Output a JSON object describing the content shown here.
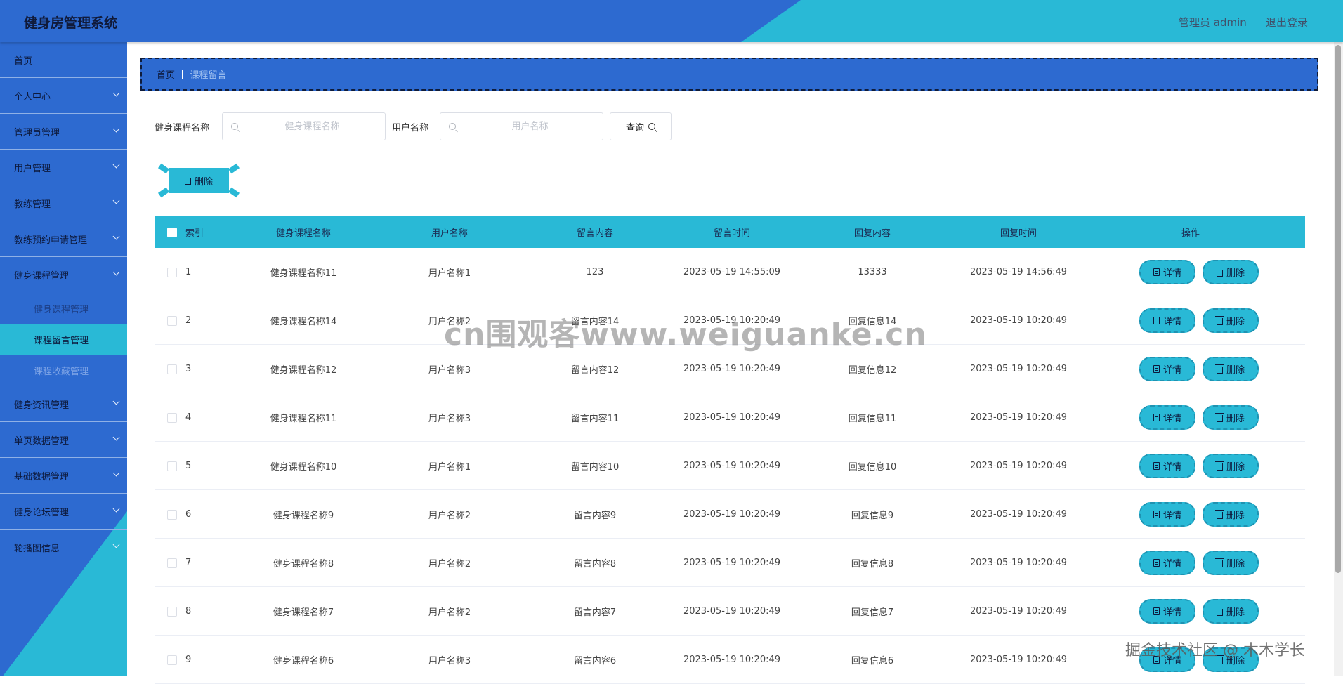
{
  "header": {
    "app_title": "健身房管理系统",
    "user_label": "管理员 admin",
    "logout_label": "退出登录"
  },
  "sidebar": {
    "items": [
      {
        "label": "首页",
        "expandable": false
      },
      {
        "label": "个人中心",
        "expandable": true
      },
      {
        "label": "管理员管理",
        "expandable": true
      },
      {
        "label": "用户管理",
        "expandable": true
      },
      {
        "label": "教练管理",
        "expandable": true
      },
      {
        "label": "教练预约申请管理",
        "expandable": true
      },
      {
        "label": "健身课程管理",
        "expandable": true,
        "expanded": true,
        "children": [
          {
            "label": "健身课程管理",
            "active": false
          },
          {
            "label": "课程留言管理",
            "active": true
          },
          {
            "label": "课程收藏管理",
            "active": false
          }
        ]
      },
      {
        "label": "健身资讯管理",
        "expandable": true
      },
      {
        "label": "单页数据管理",
        "expandable": true
      },
      {
        "label": "基础数据管理",
        "expandable": true
      },
      {
        "label": "健身论坛管理",
        "expandable": true
      },
      {
        "label": "轮播图信息",
        "expandable": true
      }
    ]
  },
  "breadcrumb": {
    "home": "首页",
    "current": "课程留言"
  },
  "search": {
    "course_label": "健身课程名称",
    "course_placeholder": "健身课程名称",
    "user_label": "用户名称",
    "user_placeholder": "用户名称",
    "query_button": "查询"
  },
  "toolbar": {
    "delete_label": "删除"
  },
  "table": {
    "columns": [
      "索引",
      "健身课程名称",
      "用户名称",
      "留言内容",
      "留言时间",
      "回复内容",
      "回复时间",
      "操作"
    ],
    "detail_label": "详情",
    "delete_label": "删除",
    "rows": [
      {
        "index": "1",
        "course": "健身课程名称11",
        "user": "用户名称1",
        "content": "123",
        "time": "2023-05-19 14:55:09",
        "reply": "13333",
        "reply_time": "2023-05-19 14:56:49"
      },
      {
        "index": "2",
        "course": "健身课程名称14",
        "user": "用户名称2",
        "content": "留言内容14",
        "time": "2023-05-19 10:20:49",
        "reply": "回复信息14",
        "reply_time": "2023-05-19 10:20:49"
      },
      {
        "index": "3",
        "course": "健身课程名称12",
        "user": "用户名称3",
        "content": "留言内容12",
        "time": "2023-05-19 10:20:49",
        "reply": "回复信息12",
        "reply_time": "2023-05-19 10:20:49"
      },
      {
        "index": "4",
        "course": "健身课程名称11",
        "user": "用户名称3",
        "content": "留言内容11",
        "time": "2023-05-19 10:20:49",
        "reply": "回复信息11",
        "reply_time": "2023-05-19 10:20:49"
      },
      {
        "index": "5",
        "course": "健身课程名称10",
        "user": "用户名称1",
        "content": "留言内容10",
        "time": "2023-05-19 10:20:49",
        "reply": "回复信息10",
        "reply_time": "2023-05-19 10:20:49"
      },
      {
        "index": "6",
        "course": "健身课程名称9",
        "user": "用户名称2",
        "content": "留言内容9",
        "time": "2023-05-19 10:20:49",
        "reply": "回复信息9",
        "reply_time": "2023-05-19 10:20:49"
      },
      {
        "index": "7",
        "course": "健身课程名称8",
        "user": "用户名称2",
        "content": "留言内容8",
        "time": "2023-05-19 10:20:49",
        "reply": "回复信息8",
        "reply_time": "2023-05-19 10:20:49"
      },
      {
        "index": "8",
        "course": "健身课程名称7",
        "user": "用户名称2",
        "content": "留言内容7",
        "time": "2023-05-19 10:20:49",
        "reply": "回复信息7",
        "reply_time": "2023-05-19 10:20:49"
      },
      {
        "index": "9",
        "course": "健身课程名称6",
        "user": "用户名称3",
        "content": "留言内容6",
        "time": "2023-05-19 10:20:49",
        "reply": "回复信息6",
        "reply_time": "2023-05-19 10:20:49"
      }
    ]
  },
  "overlay": {
    "watermark": "cn围观客www.weiguanke.cn",
    "credit": "掘金技术社区 @ 木木学长"
  },
  "colors": {
    "primary": "#2d6ad0",
    "accent": "#29b9d6",
    "text_dark": "#0d1a3d"
  }
}
